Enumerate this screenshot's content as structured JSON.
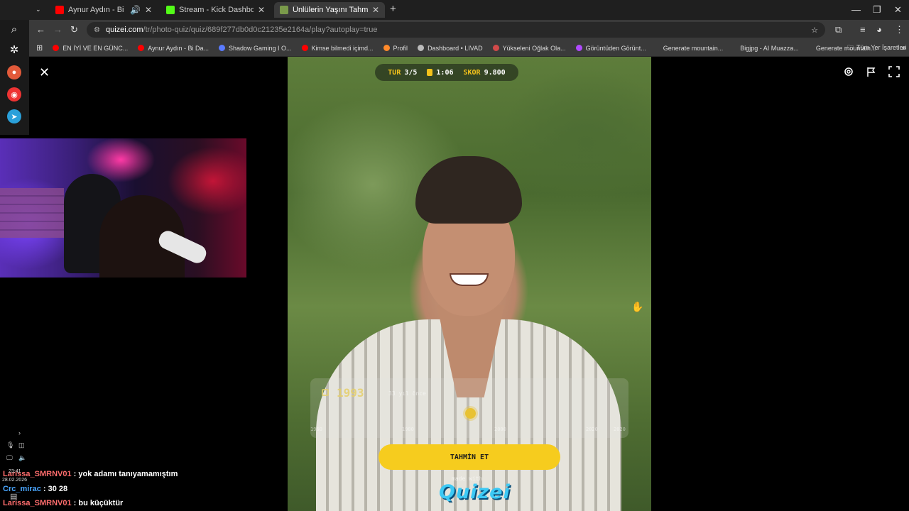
{
  "browser": {
    "tabs": [
      {
        "label": "Aynur Aydın - Bi Dakika - Ş",
        "favicon_color": "#ff0000",
        "audio": true
      },
      {
        "label": "Stream - Kick Dashboard",
        "favicon_color": "#53fc18"
      },
      {
        "label": "Ünlülerin Yaşını Tahmin Et! - Qu",
        "favicon_color": "#7a9a4a",
        "active": true
      }
    ],
    "new_tab": "+",
    "url_domain": "quizei.com",
    "url_path": "/tr/photo-quiz/quiz/689f277db0d0c21235e2164a/play?autoplay=true",
    "bookmarks": [
      {
        "label": "EN İYİ VE EN GÜNC...",
        "color": "#ff0000"
      },
      {
        "label": "Aynur Aydın - Bi Da...",
        "color": "#ff0000"
      },
      {
        "label": "Shadow Gaming I O...",
        "color": "#5a7bff"
      },
      {
        "label": "Kimse bilmedi içimd...",
        "color": "#ff0000"
      },
      {
        "label": "Profil",
        "color": "#ff8a2b"
      },
      {
        "label": "Dashboard • LIVAD",
        "color": "#bbbbbb"
      },
      {
        "label": "Yükseleni Oğlak Ola...",
        "color": "#d24a4a"
      },
      {
        "label": "Görüntüden Görünt...",
        "color": "#b04aff"
      },
      {
        "label": "Generate mountain...",
        "color": "#3a3a3a"
      },
      {
        "label": "Bigjpg - AI Muazza...",
        "color": "#3a3a3a"
      },
      {
        "label": "Generate mountain...",
        "color": "#3a3a3a"
      }
    ],
    "bookmarks_more": "»",
    "all_bookmarks": "Tüm Yer İşaretleri"
  },
  "hud": {
    "round_label": "TUR",
    "round_value": "3/5",
    "timer": "1:06",
    "score_label": "SKOR",
    "score_value": "9.800"
  },
  "slider": {
    "year": "1993",
    "ago": "33 yıl önce",
    "ticks": [
      "1960",
      "1980",
      "2000",
      "2020",
      "2020"
    ],
    "value_fraction": 0.5
  },
  "guess_button": "TAHMİN ET",
  "made_with": "made with",
  "brand": "Quizei",
  "chat": [
    {
      "user": "Larissa_SMRNV01",
      "msg": " : yok adamı tanıyamamıştım"
    },
    {
      "user": "Crc_mirac",
      "msg": " : 30 28"
    },
    {
      "user": "Larissa_SMRNV01",
      "msg": " : bu küçüktür"
    }
  ],
  "taskbar": {
    "time": "23:41",
    "date": "28.02.2026"
  },
  "colors": {
    "accent_yellow": "#f6cc1e",
    "brand_blue": "#3cc9f5"
  }
}
